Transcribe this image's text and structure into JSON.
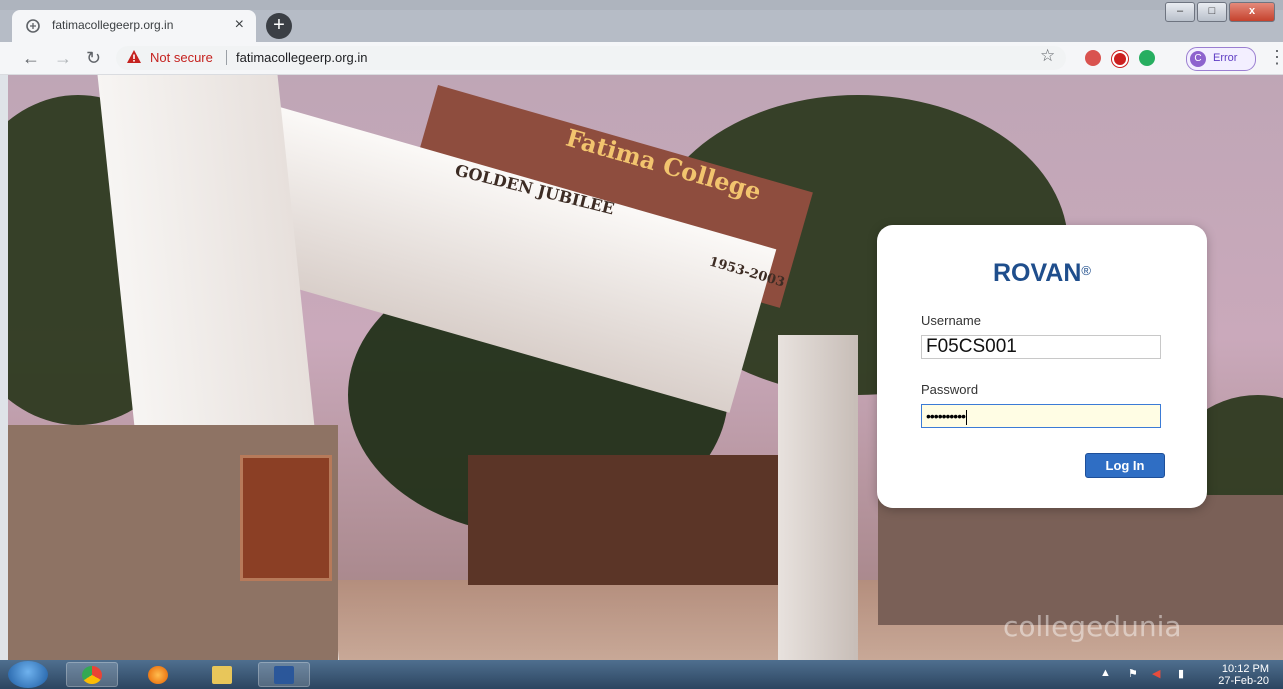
{
  "browser": {
    "tab_title": "fatimacollegeerp.org.in",
    "tab_close": "×",
    "new_tab": "+",
    "security_label": "Not secure",
    "url": "fatimacollegeerp.org.in",
    "profile_initial": "C",
    "profile_label": "Error",
    "window_min": "–",
    "window_max": "□",
    "window_close": "x"
  },
  "background": {
    "gate_name": "Fatima College",
    "jubilee": "GOLDEN JUBILEE",
    "years": "1953-2003",
    "watermark": "collegedunia"
  },
  "login": {
    "brand": "ROVAN",
    "brand_mark": "®",
    "username_label": "Username",
    "username_value": "F05CS001",
    "password_label": "Password",
    "password_value": "••••••••••",
    "login_button": "Log In"
  },
  "taskbar": {
    "apps": [
      "chrome-icon",
      "firefox-icon",
      "file-explorer-icon",
      "word-icon"
    ],
    "time": "10:12 PM",
    "date": "27-Feb-20"
  },
  "colors": {
    "brand": "#1f4e8c",
    "button": "#2f6ec4",
    "not_secure": "#c5221f"
  }
}
